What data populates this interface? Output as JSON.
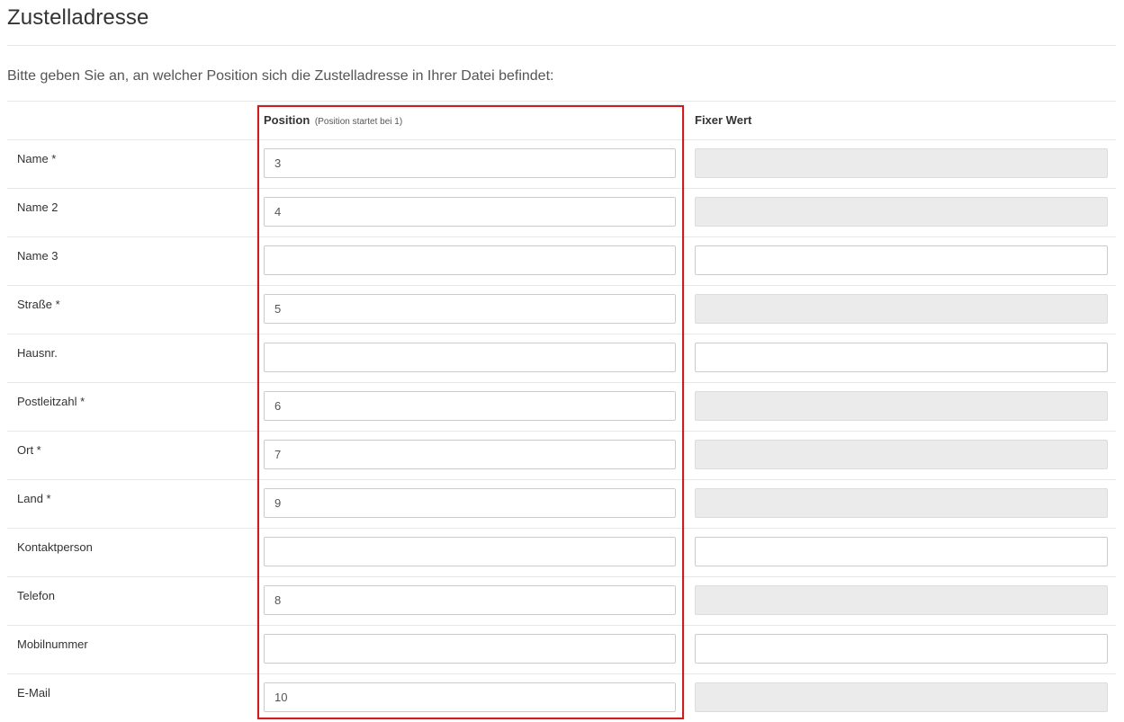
{
  "page": {
    "title": "Zustelladresse",
    "instruction": "Bitte geben Sie an, an welcher Position sich die Zustelladresse in Ihrer Datei befindet:"
  },
  "table": {
    "headers": {
      "position": "Position",
      "position_hint": "(Position startet bei 1)",
      "fixed": "Fixer Wert"
    },
    "rows": [
      {
        "label": "Name *",
        "position": "3",
        "fixed_disabled": true
      },
      {
        "label": "Name 2",
        "position": "4",
        "fixed_disabled": true
      },
      {
        "label": "Name 3",
        "position": "",
        "fixed_disabled": false
      },
      {
        "label": "Straße *",
        "position": "5",
        "fixed_disabled": true
      },
      {
        "label": "Hausnr.",
        "position": "",
        "fixed_disabled": false
      },
      {
        "label": "Postleitzahl *",
        "position": "6",
        "fixed_disabled": true
      },
      {
        "label": "Ort *",
        "position": "7",
        "fixed_disabled": true
      },
      {
        "label": "Land *",
        "position": "9",
        "fixed_disabled": true
      },
      {
        "label": "Kontaktperson",
        "position": "",
        "fixed_disabled": false
      },
      {
        "label": "Telefon",
        "position": "8",
        "fixed_disabled": true
      },
      {
        "label": "Mobilnummer",
        "position": "",
        "fixed_disabled": false
      },
      {
        "label": "E-Mail",
        "position": "10",
        "fixed_disabled": true
      }
    ]
  },
  "highlight": {
    "color": "#d01c1c"
  }
}
